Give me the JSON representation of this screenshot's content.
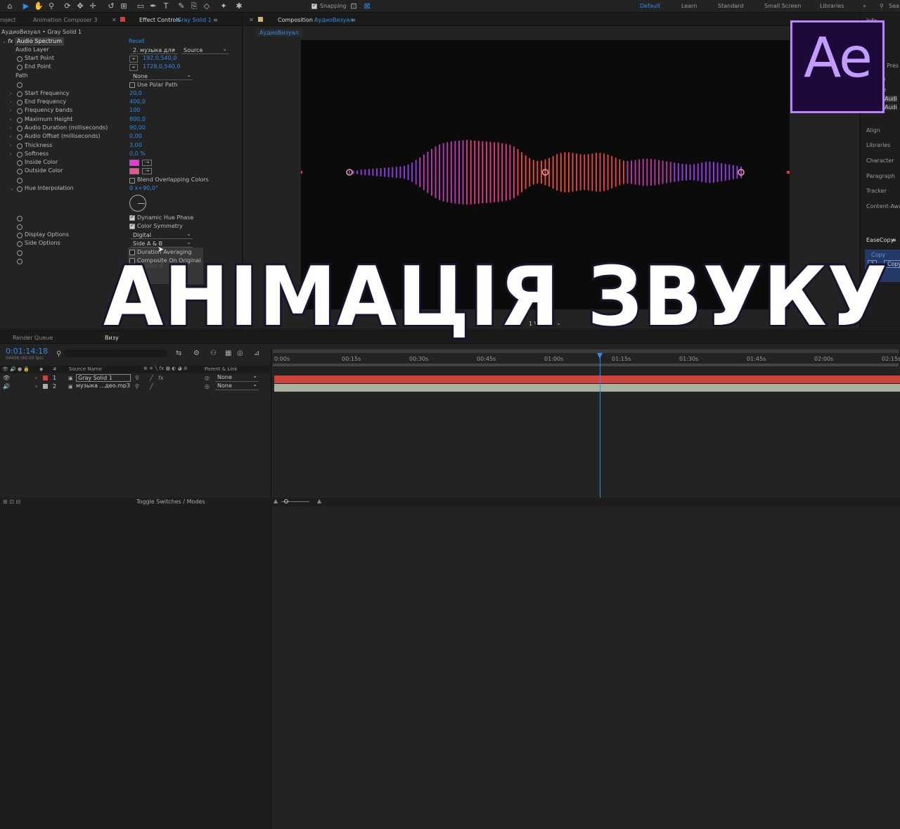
{
  "toolbar": {
    "snapping_label": "Snapping",
    "workspaces": [
      "Default",
      "Learn",
      "Standard",
      "Small Screen",
      "Libraries"
    ],
    "search_label": "Sea"
  },
  "left_panel": {
    "tabs": [
      "roject",
      "Animation Composer 3",
      "Effect Controls",
      "Gray Solid 1"
    ],
    "layer_path": "АудиоВизуал • Gray Solid 1",
    "effect_name": "Audio Spectrum",
    "reset_label": "Reset",
    "properties": {
      "audio_layer": {
        "label": "Audio Layer",
        "value": "2. музыка для",
        "source": "Source"
      },
      "start_point": {
        "label": "Start Point",
        "value": "192,0,540,0"
      },
      "end_point": {
        "label": "End Point",
        "value": "1728,0,540,0"
      },
      "path": {
        "label": "Path",
        "value": "None"
      },
      "use_polar_path": "Use Polar Path",
      "start_frequency": {
        "label": "Start Frequency",
        "value": "20,0"
      },
      "end_frequency": {
        "label": "End Frequency",
        "value": "400,0"
      },
      "frequency_bands": {
        "label": "Frequency bands",
        "value": "100"
      },
      "maximum_height": {
        "label": "Maximum Height",
        "value": "800,0"
      },
      "audio_duration": {
        "label": "Audio Duration (milliseconds)",
        "value": "90,00"
      },
      "audio_offset": {
        "label": "Audio Offset (milliseconds)",
        "value": "0,00"
      },
      "thickness": {
        "label": "Thickness",
        "value": "3,00"
      },
      "softness": {
        "label": "Softness",
        "value": "0,0 %"
      },
      "inside_color": {
        "label": "Inside Color",
        "color": "#f233e0"
      },
      "outside_color": {
        "label": "Outside Color",
        "color": "#ef5294"
      },
      "blend_overlapping": "Blend Overlapping Colors",
      "hue_interpolation": {
        "label": "Hue Interpolation",
        "value": "0 x+90,0°"
      },
      "dynamic_hue_phase": "Dynamic Hue Phase",
      "color_symmetry": "Color Symmetry",
      "display_options": {
        "label": "Display Options",
        "value": "Digital"
      },
      "side_options": {
        "label": "Side Options",
        "value": "Side A & B"
      },
      "duration_averaging": "Duration Averaging",
      "composite_on_original": "Composite On Original",
      "dropdown_option_side_b": "Side B"
    }
  },
  "comp_panel": {
    "tab_label": "Composition",
    "tab_name": "АудиоВизуал",
    "sub_tab": "АудиоВизуал",
    "view_select": "1 View"
  },
  "right_panel": {
    "items": [
      "Info",
      "k Pres",
      "lio",
      "ite",
      "Audi",
      "Audi",
      "Align",
      "Libraries",
      "Character",
      "Paragraph",
      "Tracker",
      "Content-Awa",
      "EaseCopy",
      "Copy",
      "?",
      "Copy"
    ]
  },
  "logo_text": "Ae",
  "overlay_title": "АНІМАЦІЯ ЗВУКУ",
  "timeline": {
    "tab_render": "Render Queue",
    "tab_comp": "Визу",
    "timecode": "0:01:14:18",
    "frames_info": "04458 (60.00 fps)",
    "col_source": "Source Name",
    "col_parent": "Parent & Link",
    "col_num": "#",
    "ruler_labels": [
      "0:00s",
      "00:15s",
      "00:30s",
      "00:45s",
      "01:00s",
      "01:15s",
      "01:30s",
      "01:45s",
      "02:00s",
      "02:15s"
    ],
    "playhead_time_fraction": 0.52,
    "layers": [
      {
        "num": "1",
        "name": "Gray Solid 1",
        "parent": "None",
        "color": "#d1433a"
      },
      {
        "num": "2",
        "name": "музыка ...део.mp3",
        "parent": "None",
        "color": "#a7b2a0"
      }
    ],
    "toggle_label": "Toggle Switches / Modes"
  },
  "waveform": {
    "bar_heights": [
      0.04,
      0.05,
      0.06,
      0.08,
      0.09,
      0.1,
      0.11,
      0.12,
      0.13,
      0.14,
      0.15,
      0.16,
      0.17,
      0.18,
      0.2,
      0.24,
      0.3,
      0.38,
      0.46,
      0.55,
      0.64,
      0.72,
      0.8,
      0.86,
      0.9,
      0.93,
      0.95,
      0.97,
      0.98,
      0.99,
      1.0,
      0.99,
      0.98,
      0.97,
      0.96,
      0.95,
      0.94,
      0.93,
      0.92,
      0.9,
      0.88,
      0.85,
      0.8,
      0.72,
      0.62,
      0.52,
      0.44,
      0.38,
      0.35,
      0.36,
      0.4,
      0.44,
      0.5,
      0.56,
      0.6,
      0.62,
      0.62,
      0.6,
      0.58,
      0.56,
      0.55,
      0.56,
      0.58,
      0.6,
      0.6,
      0.58,
      0.55,
      0.5,
      0.45,
      0.4,
      0.36,
      0.35,
      0.36,
      0.38,
      0.4,
      0.42,
      0.42,
      0.41,
      0.4,
      0.38,
      0.36,
      0.34,
      0.32,
      0.3,
      0.28,
      0.26,
      0.25,
      0.24,
      0.25,
      0.27,
      0.3,
      0.32,
      0.33,
      0.32,
      0.3,
      0.28,
      0.26,
      0.24,
      0.22,
      0.2,
      0.18
    ]
  }
}
